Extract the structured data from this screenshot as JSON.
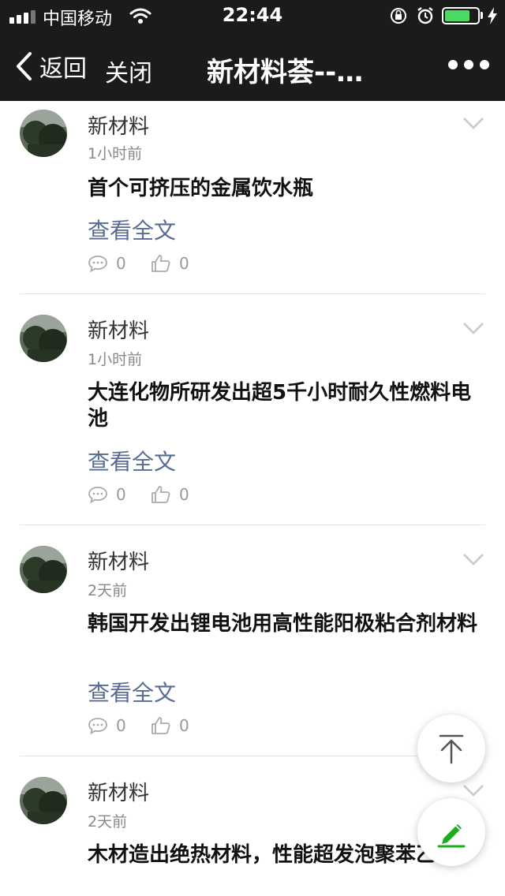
{
  "status_bar": {
    "carrier": "中国移动",
    "time": "22:44",
    "battery_level": 0.78,
    "battery_color": "#4cd964"
  },
  "nav": {
    "back_label": "返回",
    "close_label": "关闭",
    "title": "新材料荟--…"
  },
  "posts": [
    {
      "author": "新材料",
      "time": "1小时前",
      "title": "首个可挤压的金属饮水瓶",
      "read_more": "查看全文",
      "comments": "0",
      "likes": "0"
    },
    {
      "author": "新材料",
      "time": "1小时前",
      "title": "大连化物所研发出超5千小时耐久性燃料电池",
      "read_more": "查看全文",
      "comments": "0",
      "likes": "0"
    },
    {
      "author": "新材料",
      "time": "2天前",
      "title": "韩国开发出锂电池用高性能阳极粘合剂材料",
      "read_more": "查看全文",
      "comments": "0",
      "likes": "0"
    },
    {
      "author": "新材料",
      "time": "2天前",
      "title": "木材造出绝热材料，性能超发泡聚苯乙烯"
    }
  ],
  "icons": {
    "back": "chevron-left-icon",
    "more": "more-dots-icon",
    "collapse": "chevron-down-icon",
    "comment": "comment-icon",
    "like": "thumbs-up-icon",
    "scroll_top": "arrow-up-icon",
    "write": "pencil-icon"
  },
  "colors": {
    "nav_background": "#1b1b1b",
    "link": "#576b95",
    "accent_green": "#1aad19"
  }
}
